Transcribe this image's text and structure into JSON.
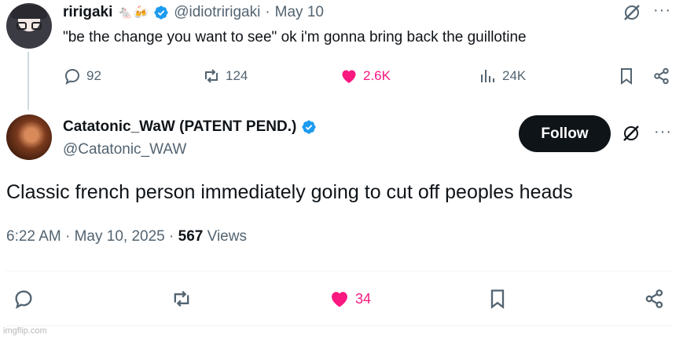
{
  "parent_tweet": {
    "display_name": "ririgaki",
    "emoji": "🐁🍻",
    "handle": "@idiotririgaki",
    "separator": "·",
    "date": "May 10",
    "text": "\"be the change you want to see\" ok i'm gonna bring back the guillotine",
    "replies": "92",
    "reposts": "124",
    "likes": "2.6K",
    "views": "24K"
  },
  "main_tweet": {
    "display_name": "Catatonic_WaW (PATENT PEND.)",
    "handle": "@Catatonic_WAW",
    "follow_label": "Follow",
    "text": "Classic french person immediately going to cut off peoples heads",
    "time": "6:22 AM",
    "date": "May 10, 2025",
    "separator": "·",
    "views_count": "567",
    "views_label": "Views",
    "likes": "34"
  },
  "more_label": "···",
  "watermark": "imgflip.com",
  "colors": {
    "verified": "#1d9bf0",
    "liked": "#f91880",
    "text": "#0f1419",
    "muted": "#536471",
    "follow_bg": "#0f1419"
  },
  "icons": [
    "reply-icon",
    "repost-icon",
    "like-icon",
    "views-icon",
    "bookmark-icon",
    "share-icon",
    "grok-icon",
    "more-icon",
    "verified-badge-icon"
  ]
}
